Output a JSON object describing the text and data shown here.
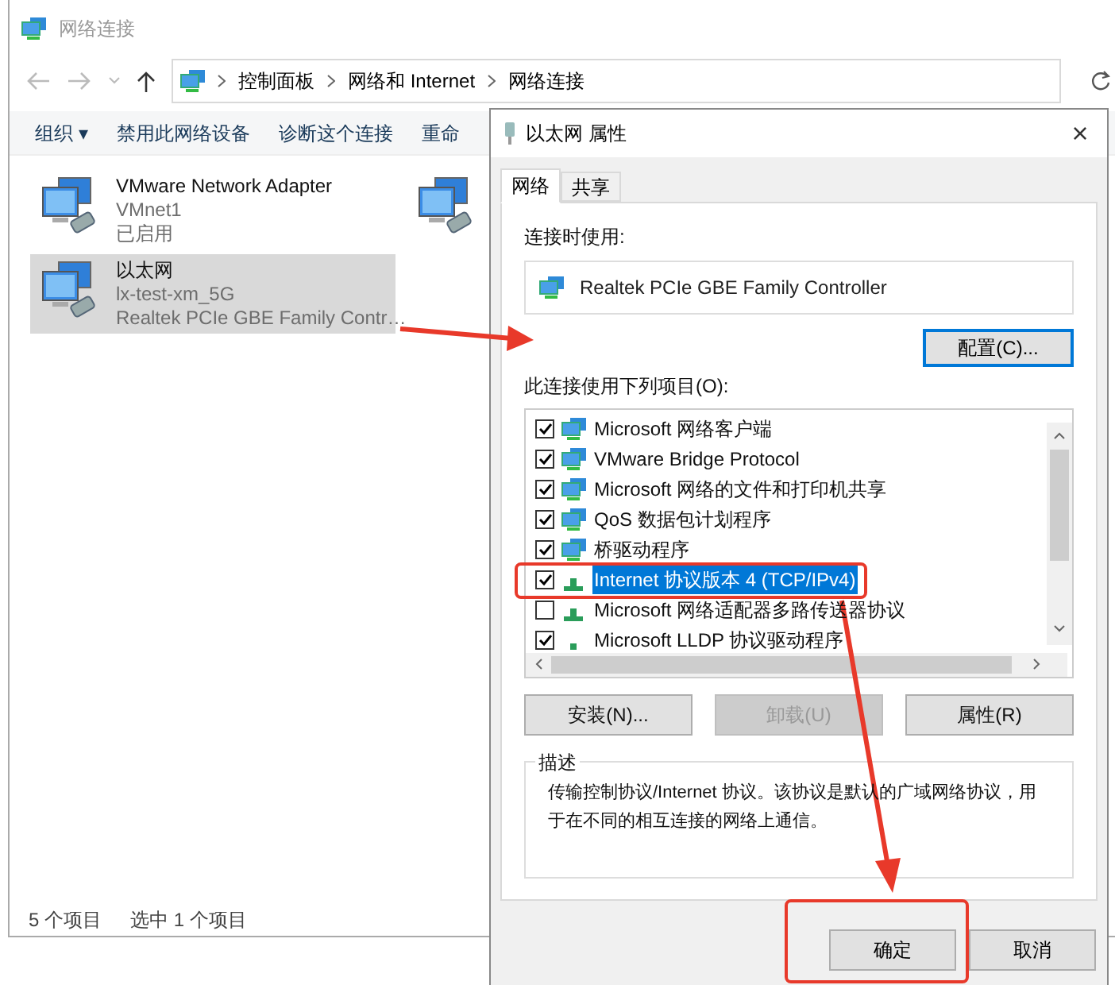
{
  "explorer": {
    "title": "网络连接",
    "breadcrumb": [
      "控制面板",
      "网络和 Internet",
      "网络连接"
    ],
    "toolbar": [
      "组织 ▾",
      "禁用此网络设备",
      "诊断这个连接",
      "重命"
    ],
    "items": [
      {
        "lines": [
          "VMware Network Adapter",
          "VMnet1",
          "已启用"
        ],
        "selected": false
      },
      {
        "selected": false
      },
      {
        "lines": [
          "以太网",
          "lx-test-xm_5G",
          "Realtek PCIe GBE Family Contr…"
        ],
        "selected": true
      }
    ],
    "status_bar": [
      "5 个项目",
      "选中 1 个项目"
    ]
  },
  "dialog": {
    "title": "以太网 属性",
    "close": "×",
    "tabs": [
      {
        "label": "网络",
        "selected": true
      },
      {
        "label": "共享",
        "selected": false
      }
    ],
    "connect_using_label": "连接时使用:",
    "adapter": "Realtek PCIe GBE Family Controller",
    "configure_button": "配置(C)...",
    "items_label": "此连接使用下列项目(O):",
    "components": [
      {
        "label": "Microsoft 网络客户端",
        "checked": true,
        "selected": false,
        "kind": "service"
      },
      {
        "label": "VMware Bridge Protocol",
        "checked": true,
        "selected": false,
        "kind": "service"
      },
      {
        "label": "Microsoft 网络的文件和打印机共享",
        "checked": true,
        "selected": false,
        "kind": "service"
      },
      {
        "label": "QoS 数据包计划程序",
        "checked": true,
        "selected": false,
        "kind": "service"
      },
      {
        "label": "桥驱动程序",
        "checked": true,
        "selected": false,
        "kind": "service"
      },
      {
        "label": "Internet 协议版本 4 (TCP/IPv4)",
        "checked": true,
        "selected": true,
        "kind": "protocol"
      },
      {
        "label": "Microsoft 网络适配器多路传送器协议",
        "checked": false,
        "selected": false,
        "kind": "protocol"
      },
      {
        "label": "Microsoft LLDP 协议驱动程序",
        "checked": true,
        "selected": false,
        "kind": "driver"
      }
    ],
    "action_buttons": [
      {
        "label": "安装(N)...",
        "disabled": false
      },
      {
        "label": "卸载(U)",
        "disabled": true
      },
      {
        "label": "属性(R)",
        "disabled": false
      }
    ],
    "description_title": "描述",
    "description": "传输控制协议/Internet 协议。该协议是默认的广域网络协议，用于在不同的相互连接的网络上通信。",
    "ok_button": "确定",
    "cancel_button": "取消"
  }
}
